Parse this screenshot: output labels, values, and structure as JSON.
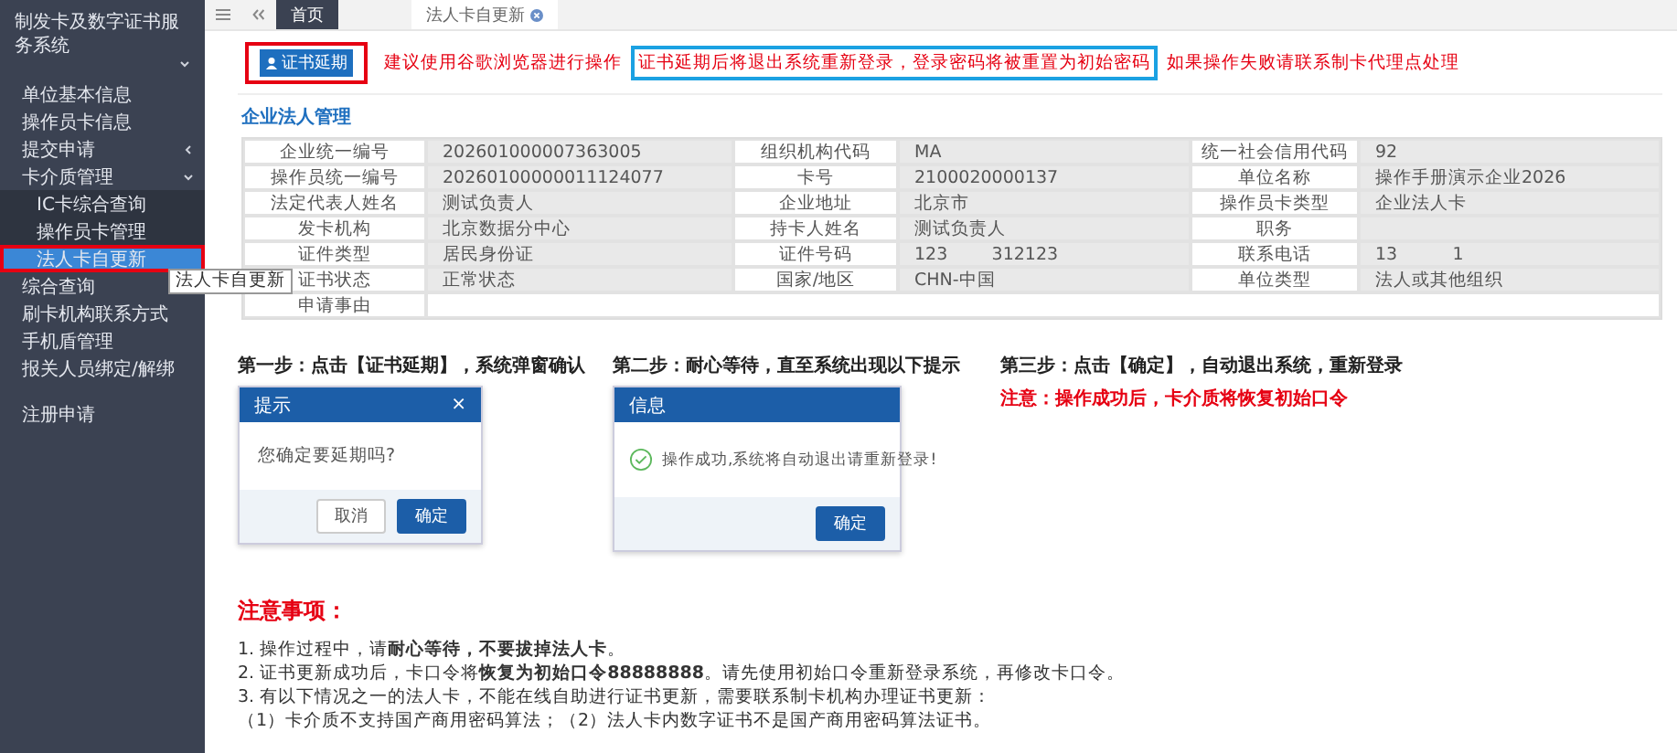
{
  "sidebar": {
    "title": "制发卡及数字证书服务系统",
    "title_expanded": true,
    "items": [
      {
        "label": "单位基本信息",
        "kind": "link",
        "selected": false
      },
      {
        "label": "操作员卡信息",
        "kind": "link",
        "selected": false
      },
      {
        "label": "提交申请",
        "kind": "group",
        "expanded": false,
        "selected": false
      },
      {
        "label": "卡介质管理",
        "kind": "group",
        "expanded": true,
        "selected": false,
        "children": [
          {
            "label": "IC卡综合查询",
            "selected": false
          },
          {
            "label": "操作员卡管理",
            "selected": false
          },
          {
            "label": "法人卡自更新",
            "selected": true
          }
        ]
      },
      {
        "label": "综合查询",
        "kind": "link",
        "selected": false
      },
      {
        "label": "刷卡机构联系方式",
        "kind": "link",
        "selected": false
      },
      {
        "label": "手机盾管理",
        "kind": "link",
        "selected": false
      },
      {
        "label": "报关人员绑定/解绑",
        "kind": "link",
        "selected": false
      },
      {
        "label": "注册申请",
        "kind": "link",
        "selected": false
      }
    ],
    "tooltip": "法人卡自更新"
  },
  "tabs": [
    {
      "label": "首页",
      "selected": false,
      "closable": false
    },
    {
      "label": "法人卡自更新",
      "selected": true,
      "closable": true
    }
  ],
  "toolbar": {
    "button": "证书延期",
    "notices": [
      {
        "text": "建议使用谷歌浏览器进行操作",
        "boxed": false
      },
      {
        "text": "证书延期后将退出系统重新登录，登录密码将被重置为初始密码",
        "boxed": true
      },
      {
        "text": "如果操作失败请联系制卡代理点处理",
        "boxed": false
      }
    ]
  },
  "section_title": "企业法人管理",
  "table": {
    "rows": [
      [
        {
          "label": "企业统一编号",
          "value": "202601000007363005"
        },
        {
          "label": "组织机构代码",
          "value": "MA"
        },
        {
          "label": "统一社会信用代码",
          "value": "92"
        }
      ],
      [
        {
          "label": "操作员统一编号",
          "value": "20260100000011124077"
        },
        {
          "label": "卡号",
          "value": "2100020000137"
        },
        {
          "label": "单位名称",
          "value": "操作手册演示企业2026"
        }
      ],
      [
        {
          "label": "法定代表人姓名",
          "value": "测试负责人"
        },
        {
          "label": "企业地址",
          "value": "北京市"
        },
        {
          "label": "操作员卡类型",
          "value": "企业法人卡"
        }
      ],
      [
        {
          "label": "发卡机构",
          "value": "北京数据分中心"
        },
        {
          "label": "持卡人姓名",
          "value": "测试负责人"
        },
        {
          "label": "职务"
        }
      ],
      [
        {
          "label": "证件类型",
          "value": "居民身份证"
        },
        {
          "label": "证件号码",
          "value": "123        312123"
        },
        {
          "label": "联系电话",
          "value": "13          1"
        }
      ],
      [
        {
          "label": "证书状态",
          "value": "正常状态"
        },
        {
          "label": "国家/地区",
          "value": "CHN-中国"
        },
        {
          "label": "单位类型",
          "value": "法人或其他组织"
        }
      ],
      [
        {
          "label": "申请事由"
        }
      ]
    ]
  },
  "steps": [
    {
      "title": "第一步：点击【证书延期】，系统弹窗确认",
      "dialog": {
        "kind": "confirm",
        "title": "提示",
        "close": "×",
        "message": "您确定要延期吗?",
        "buttons": [
          {
            "label": "取消",
            "primary": false
          },
          {
            "label": "确定",
            "primary": true
          }
        ]
      }
    },
    {
      "title": "第二步：**耐心等待**，直至系统出现以下提示",
      "dialog": {
        "kind": "success",
        "title": "信息",
        "message": "操作成功,系统将自动退出请重新登录!",
        "buttons": [
          {
            "label": "确定",
            "primary": true
          }
        ]
      }
    },
    {
      "title": "第三步：点击【确定】，自动退出系统，重新登录",
      "note": "注意：操作成功后，卡介质将恢复初始口令"
    }
  ],
  "notes": {
    "title": "注意事项：",
    "lines": [
      "1. 操作过程中，请**耐心等待，不要拔掉法人卡**。",
      "2. 证书更新成功后，卡口令将**恢复为初始口令88888888**。请先使用初始口令重新登录系统，再修改卡口令。",
      "3. 有以下情况之一的法人卡，不能在线自助进行证书更新，需要联系制卡机构办理证书更新：",
      "（1）卡介质不支持国产商用密码算法；（2）法人卡内数字证书不是国产商用密码算法证书。"
    ]
  }
}
